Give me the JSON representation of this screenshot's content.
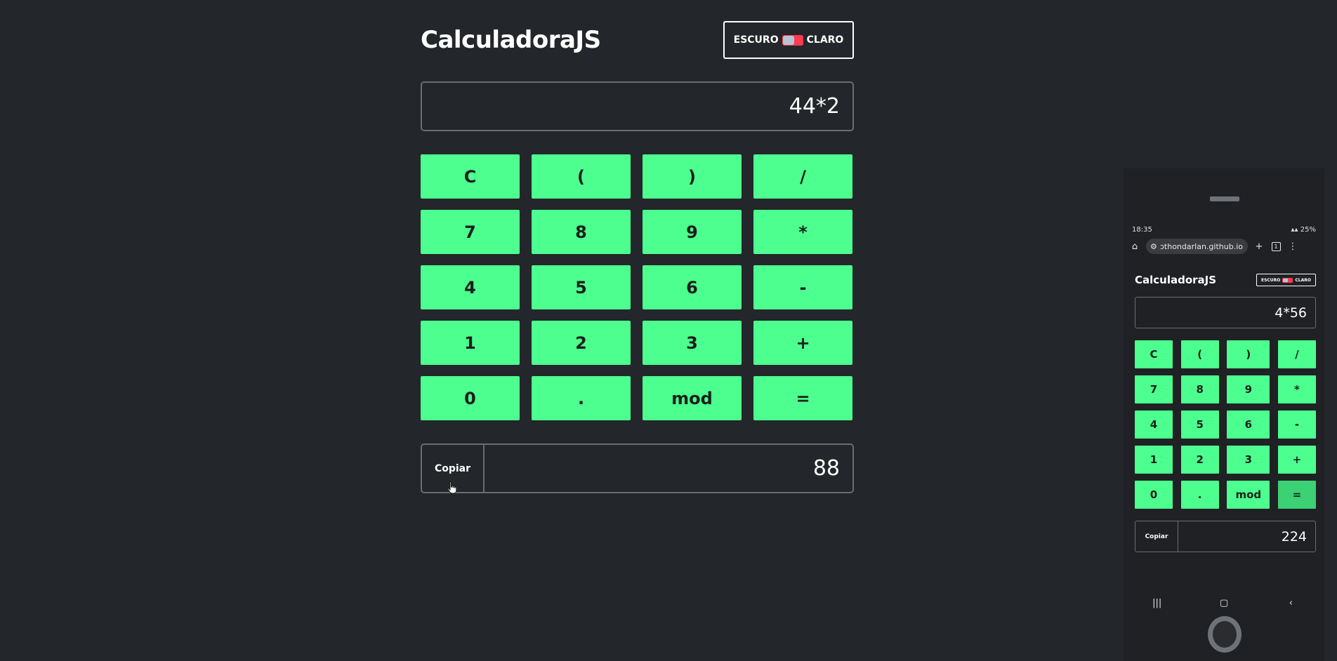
{
  "app": {
    "title": "CalculadoraJS",
    "theme": {
      "left_label": "ESCURO",
      "right_label": "CLARO"
    },
    "expression": "44*2",
    "keys": [
      "C",
      "(",
      ")",
      "/",
      "7",
      "8",
      "9",
      "*",
      "4",
      "5",
      "6",
      "-",
      "1",
      "2",
      "3",
      "+",
      "0",
      ".",
      "mod",
      "="
    ],
    "copy_label": "Copiar",
    "result": "88"
  },
  "phone": {
    "status_time": "18:35",
    "status_battery": "25%",
    "url": "ɔthondarlan.github.io",
    "tab_count": "1",
    "title": "CalculadoraJS",
    "theme": {
      "left_label": "ESCURO",
      "right_label": "CLARO"
    },
    "expression": "4*56",
    "keys": [
      "C",
      "(",
      ")",
      "/",
      "7",
      "8",
      "9",
      "*",
      "4",
      "5",
      "6",
      "-",
      "1",
      "2",
      "3",
      "+",
      "0",
      ".",
      "mod",
      "="
    ],
    "copy_label": "Copiar",
    "result": "224"
  },
  "colors": {
    "background": "#23262a",
    "key": "#4cff8e",
    "toggle": "#ff3b4f"
  }
}
